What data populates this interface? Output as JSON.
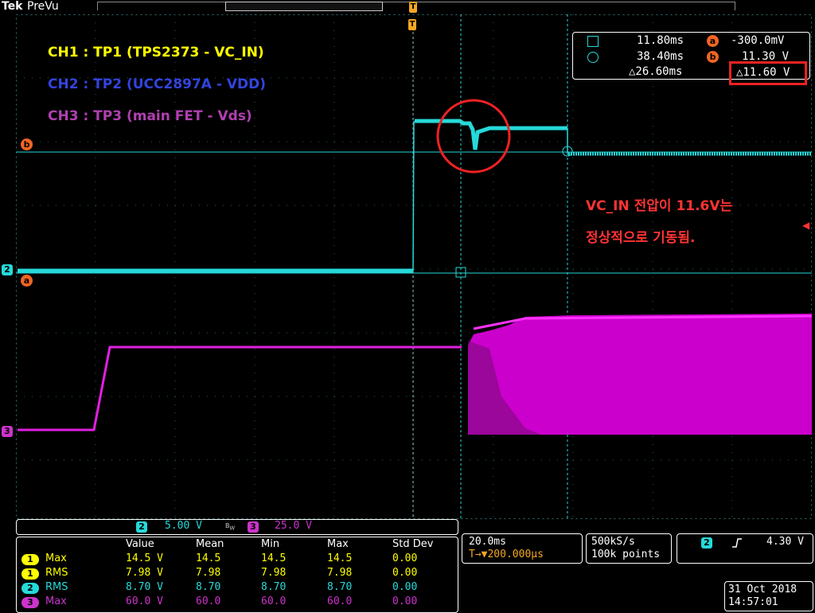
{
  "brand": {
    "tek": "Tek",
    "mode": "PreVu"
  },
  "trigger_marker": "T",
  "legend": {
    "ch1": "CH1 : TP1 (TPS2373 - VC_IN)",
    "ch2": "CH2 : TP2 (UCC2897A - VDD)",
    "ch3": "CH3 : TP3 (main FET - Vds)"
  },
  "annotation": {
    "line1": "VC_IN 전압이 11.6V는",
    "line2": "정상적으로 기동됨."
  },
  "cursors": {
    "t1": "11.80ms",
    "t2": "38.40ms",
    "dt": "△26.60ms",
    "a_label": "a",
    "a_value": "-300.0mV",
    "b_label": "b",
    "b_value": "11.30 V",
    "dv": "△11.60 V"
  },
  "left_markers": {
    "b": "b",
    "ch2": "2",
    "a": "a",
    "ch3": "3"
  },
  "vertical": {
    "ch2_tag": "2",
    "ch2_scale": "5.00 V",
    "bw": "B_W",
    "ch3_tag": "3",
    "ch3_scale": "25.0 V"
  },
  "measurements": {
    "headers": [
      "Value",
      "Mean",
      "Min",
      "Max",
      "Std Dev"
    ],
    "rows": [
      {
        "ch": "1",
        "name": "Max",
        "value": "14.5 V",
        "mean": "14.5",
        "min": "14.5",
        "max": "14.5",
        "std": "0.00",
        "color": "#ffff00"
      },
      {
        "ch": "1",
        "name": "RMS",
        "value": "7.98 V",
        "mean": "7.98",
        "min": "7.98",
        "max": "7.98",
        "std": "0.00",
        "color": "#ffff00"
      },
      {
        "ch": "2",
        "name": "RMS",
        "value": "8.70 V",
        "mean": "8.70",
        "min": "8.70",
        "max": "8.70",
        "std": "0.00",
        "color": "#26d9d9"
      },
      {
        "ch": "3",
        "name": "Max",
        "value": "60.0 V",
        "mean": "60.0",
        "min": "60.0",
        "max": "60.0",
        "std": "0.00",
        "color": "#cc33cc"
      }
    ]
  },
  "timebase": {
    "scale": "20.0ms",
    "delay": "T→▼200.000μs"
  },
  "acquisition": {
    "rate": "500kS/s",
    "points": "100k points"
  },
  "trigger": {
    "ch": "2",
    "slope_icon": "rising-edge-icon",
    "level": "4.30 V"
  },
  "datetime": {
    "date": "31 Oct  2018",
    "time": "14:57:01"
  },
  "colors": {
    "ch1": "#ffff00",
    "ch2": "#26d9d9",
    "ch3": "#ff1aff",
    "cursor_marker": "#f26522",
    "annotation": "#ff3333"
  }
}
